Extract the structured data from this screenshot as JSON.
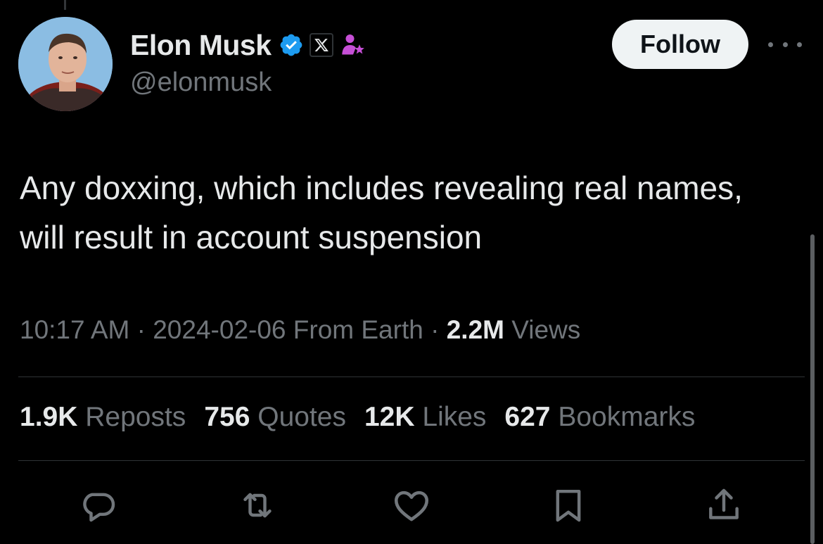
{
  "author": {
    "name": "Elon Musk",
    "handle": "@elonmusk",
    "verified": true,
    "affiliate_badge": "X"
  },
  "follow_button": {
    "label": "Follow"
  },
  "tweet": {
    "text": "Any doxxing, which includes revealing real names, will result in account suspension",
    "time": "10:17 AM",
    "date": "2024-02-06",
    "source": "From Earth",
    "views_count": "2.2M",
    "views_label": "Views",
    "separator": "·"
  },
  "stats": [
    {
      "count": "1.9K",
      "label": "Reposts"
    },
    {
      "count": "756",
      "label": "Quotes"
    },
    {
      "count": "12K",
      "label": "Likes"
    },
    {
      "count": "627",
      "label": "Bookmarks"
    }
  ],
  "actions": [
    "reply-icon",
    "repost-icon",
    "like-icon",
    "bookmark-icon",
    "share-icon"
  ],
  "colors": {
    "background": "#000000",
    "text": "#e7e9ea",
    "secondary": "#71767b",
    "verified_blue": "#1d9bf0",
    "affiliate_pink": "#c64fd6",
    "divider": "#2f3336"
  }
}
